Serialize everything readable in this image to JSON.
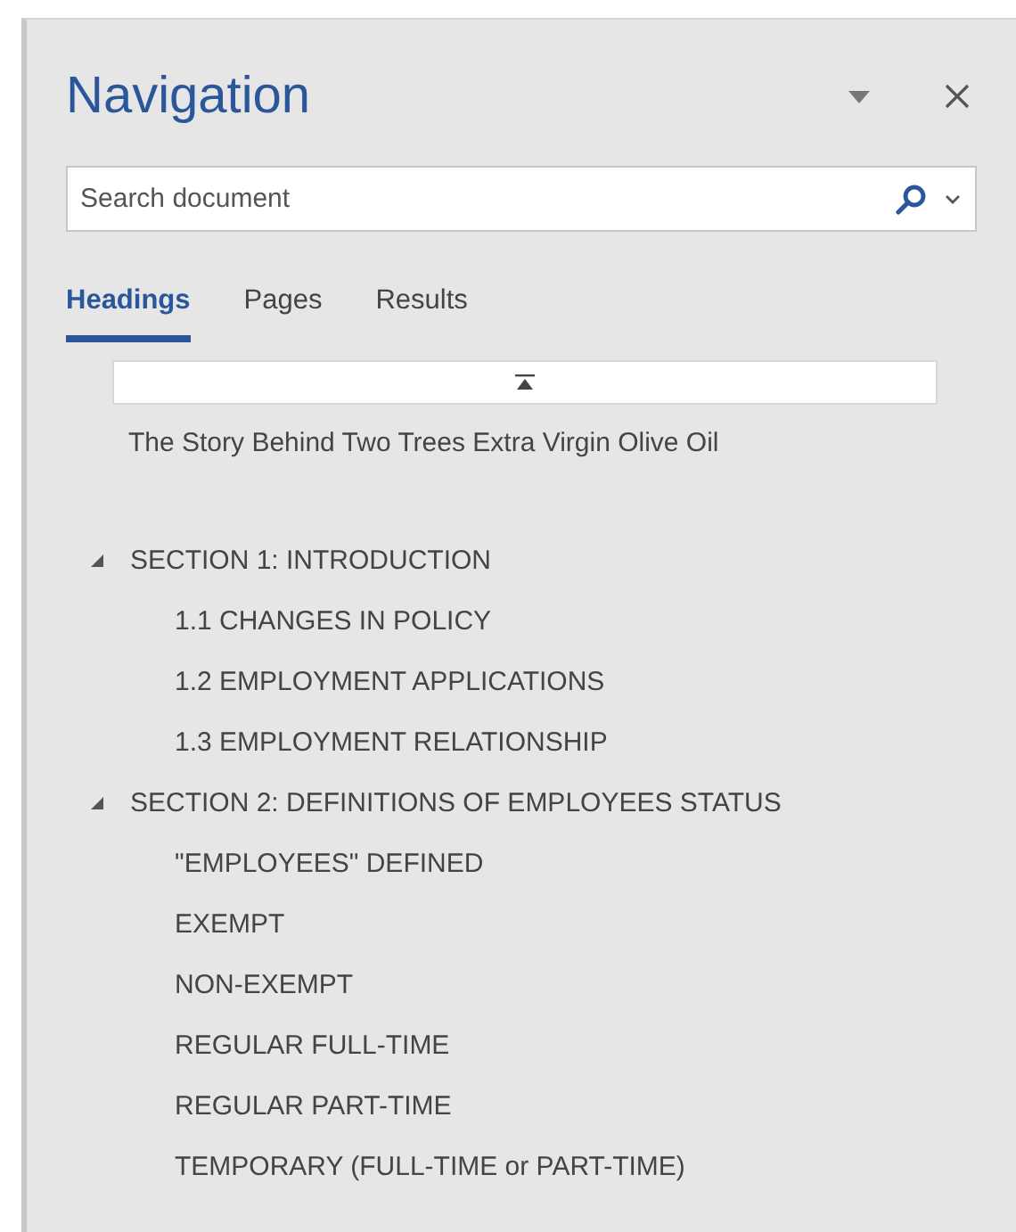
{
  "pane": {
    "title": "Navigation"
  },
  "search": {
    "placeholder": "Search document"
  },
  "tabs": [
    {
      "label": "Headings",
      "selected": true
    },
    {
      "label": "Pages",
      "selected": false
    },
    {
      "label": "Results",
      "selected": false
    }
  ],
  "headings": [
    {
      "label": "The Story Behind Two Trees Extra Virgin Olive Oil"
    },
    {
      "label": "SECTION 1: INTRODUCTION",
      "expanded": true,
      "children": [
        {
          "label": "1.1 CHANGES IN POLICY"
        },
        {
          "label": "1.2 EMPLOYMENT APPLICATIONS"
        },
        {
          "label": "1.3 EMPLOYMENT RELATIONSHIP"
        }
      ]
    },
    {
      "label": "SECTION 2: DEFINITIONS OF EMPLOYEES STATUS",
      "expanded": true,
      "children": [
        {
          "label": "\"EMPLOYEES\" DEFINED"
        },
        {
          "label": "EXEMPT"
        },
        {
          "label": "NON-EXEMPT"
        },
        {
          "label": "REGULAR FULL-TIME"
        },
        {
          "label": "REGULAR PART-TIME"
        },
        {
          "label": "TEMPORARY (FULL-TIME or PART-TIME)"
        }
      ]
    }
  ]
}
